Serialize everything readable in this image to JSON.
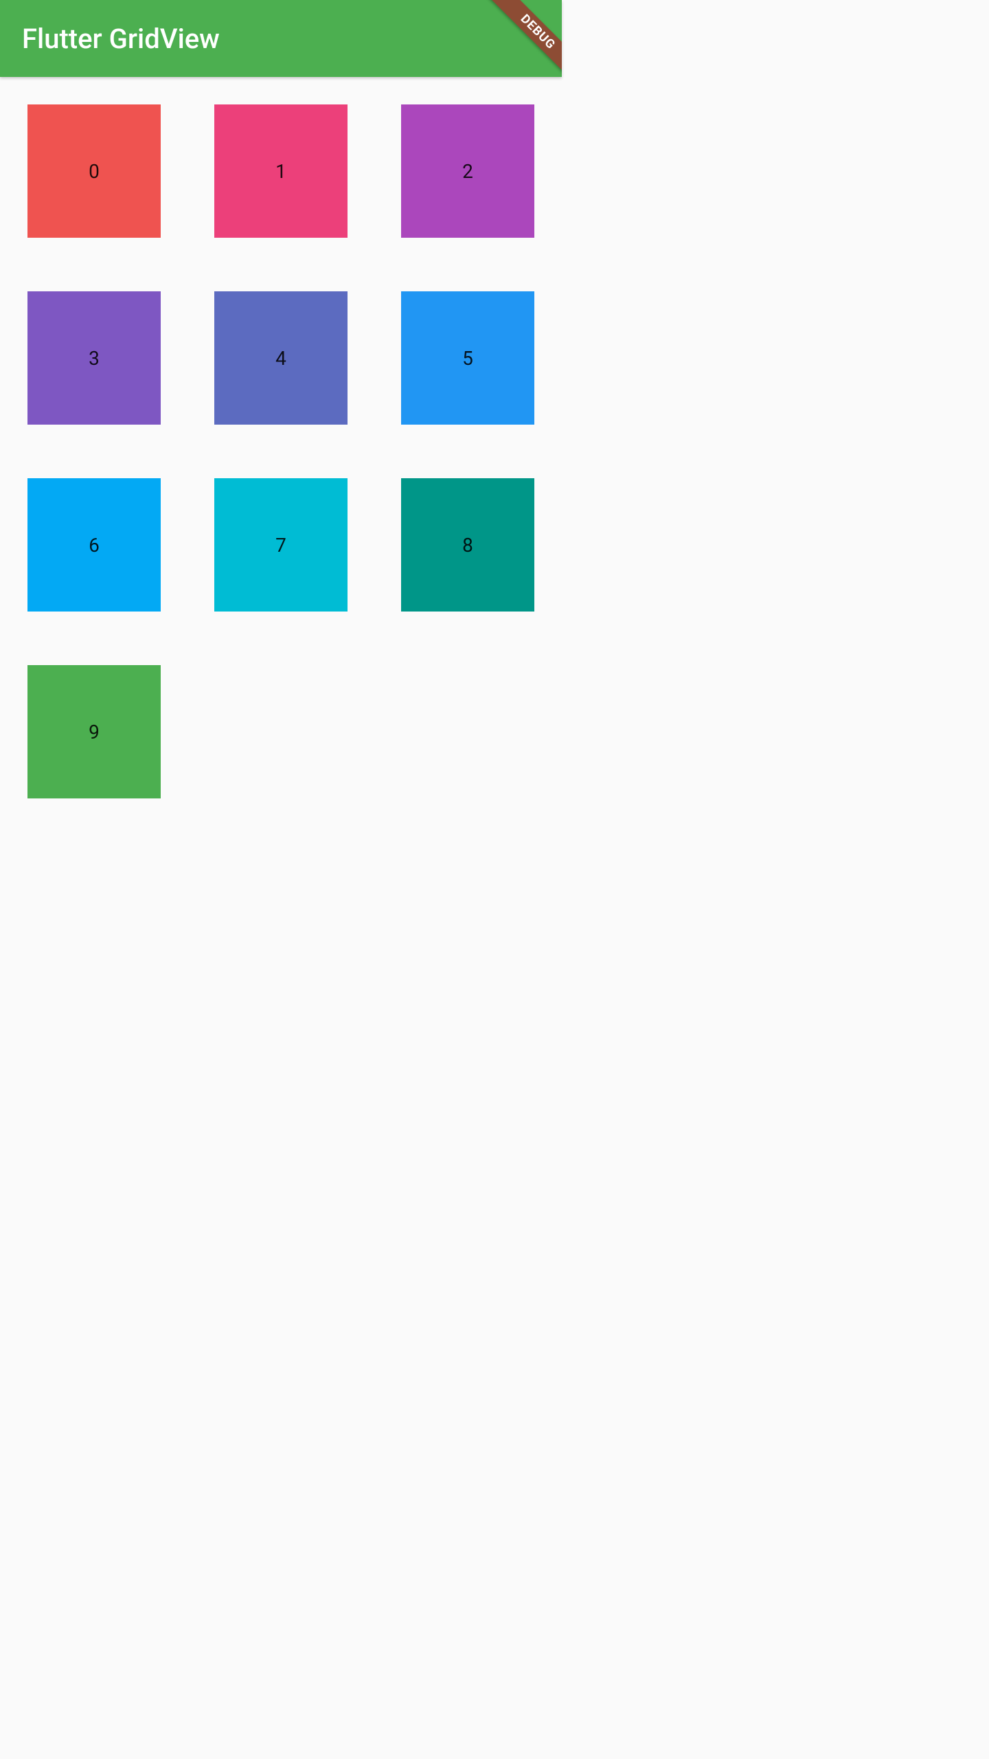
{
  "appBar": {
    "title": "Flutter GridView"
  },
  "debugBanner": {
    "label": "DEBUG"
  },
  "grid": {
    "tiles": [
      {
        "label": "0",
        "color": "#ef5350"
      },
      {
        "label": "1",
        "color": "#ec407a"
      },
      {
        "label": "2",
        "color": "#ab47bc"
      },
      {
        "label": "3",
        "color": "#7e57c2"
      },
      {
        "label": "4",
        "color": "#5c6bc0"
      },
      {
        "label": "5",
        "color": "#2196f3"
      },
      {
        "label": "6",
        "color": "#03a9f4"
      },
      {
        "label": "7",
        "color": "#00bcd4"
      },
      {
        "label": "8",
        "color": "#009688"
      },
      {
        "label": "9",
        "color": "#4caf50"
      }
    ]
  }
}
